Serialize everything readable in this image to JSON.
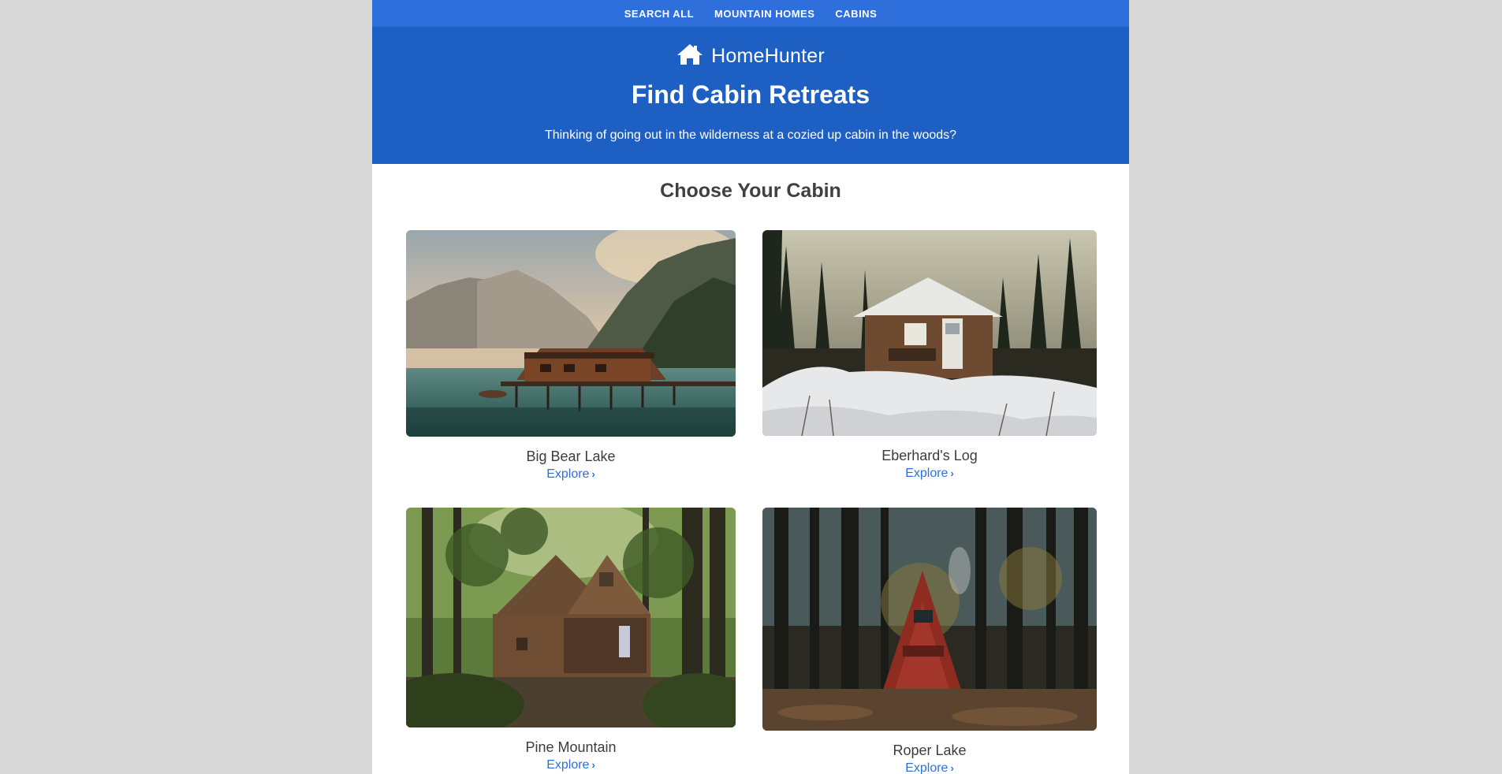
{
  "nav": {
    "items": [
      {
        "label": "SEARCH ALL"
      },
      {
        "label": "MOUNTAIN HOMES"
      },
      {
        "label": "CABINS"
      }
    ]
  },
  "brand": {
    "name": "HomeHunter",
    "icon": "house-icon"
  },
  "hero": {
    "title": "Find Cabin Retreats",
    "subtitle": "Thinking of going out in the wilderness at a cozied up cabin in the woods?"
  },
  "section": {
    "title": "Choose Your Cabin"
  },
  "cabins": [
    {
      "name": "Big Bear Lake",
      "link": "Explore"
    },
    {
      "name": "Eberhard's Log",
      "link": "Explore"
    },
    {
      "name": "Pine Mountain",
      "link": "Explore"
    },
    {
      "name": "Roper Lake",
      "link": "Explore"
    }
  ],
  "colors": {
    "nav_bg": "#2f6fdc",
    "hero_bg": "#1e5fc3",
    "link": "#2f6fdc",
    "page_bg": "#d8d8d8"
  }
}
